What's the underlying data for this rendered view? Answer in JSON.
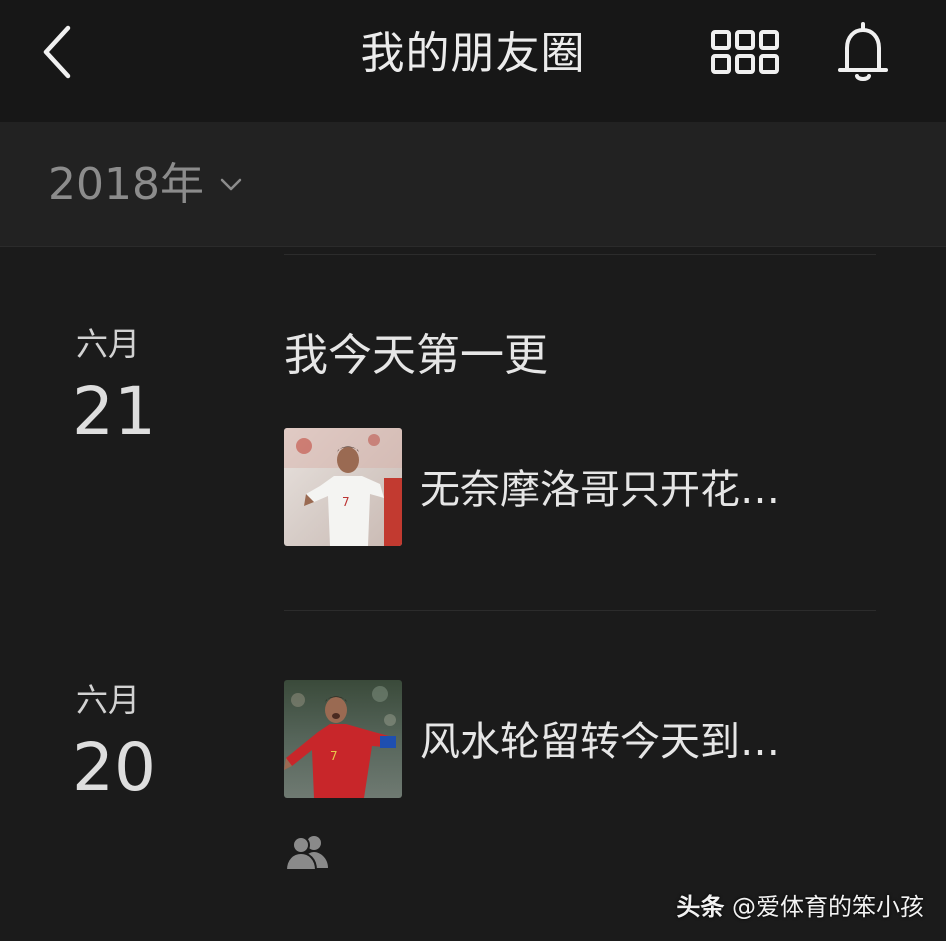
{
  "header": {
    "title": "我的朋友圈",
    "back_icon": "chevron-left-icon",
    "grid_icon": "grid-icon",
    "bell_icon": "bell-icon"
  },
  "year_selector": {
    "label": "2018年",
    "icon": "chevron-down-icon"
  },
  "entries": [
    {
      "month": "六月",
      "day": "21",
      "text": "我今天第一更",
      "link_title": "无奈摩洛哥只开花…"
    },
    {
      "month": "六月",
      "day": "20",
      "link_title": "风水轮留转今天到…",
      "visibility_icon": "friends-icon"
    }
  ],
  "watermark": {
    "brand": "头条",
    "handle": "@爱体育的笨小孩"
  },
  "colors": {
    "background": "#1b1b1b",
    "navbar": "#171717",
    "year_bar": "#222222",
    "text": "#e6e6e6",
    "muted": "#8c8c8c"
  }
}
